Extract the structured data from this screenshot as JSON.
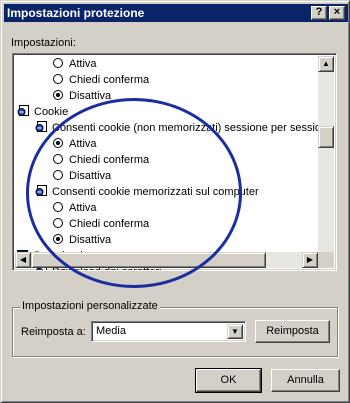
{
  "window": {
    "title": "Impostazioni protezione",
    "help_button": "?",
    "close_button": "×"
  },
  "settings": {
    "label": "Impostazioni:",
    "items": [
      {
        "kind": "radio",
        "label": "Attiva",
        "checked": false
      },
      {
        "kind": "radio",
        "label": "Chiedi conferma",
        "checked": false
      },
      {
        "kind": "radio",
        "label": "Disattiva",
        "checked": true
      },
      {
        "kind": "category",
        "label": "Cookie",
        "icon": "settings-page-icon"
      },
      {
        "kind": "subcategory",
        "label": "Consenti cookie (non memorizzati) sessione per sessione",
        "icon": "settings-page-icon"
      },
      {
        "kind": "radio",
        "label": "Attiva",
        "checked": true
      },
      {
        "kind": "radio",
        "label": "Chiedi conferma",
        "checked": false
      },
      {
        "kind": "radio",
        "label": "Disattiva",
        "checked": false
      },
      {
        "kind": "subcategory",
        "label": "Consenti cookie memorizzati sul computer",
        "icon": "settings-page-icon"
      },
      {
        "kind": "radio",
        "label": "Attiva",
        "checked": false
      },
      {
        "kind": "radio",
        "label": "Chiedi conferma",
        "checked": false
      },
      {
        "kind": "radio",
        "label": "Disattiva",
        "checked": true
      },
      {
        "kind": "category",
        "label": "Download",
        "icon": "download-icon"
      },
      {
        "kind": "subcategory",
        "label": "Download dei caratteri",
        "icon": "settings-page-icon"
      }
    ]
  },
  "custom": {
    "group_title": "Impostazioni personalizzate",
    "reset_label": "Reimposta a:",
    "reset_value": "Media",
    "reset_button": "Reimposta"
  },
  "footer": {
    "ok": "OK",
    "cancel": "Annulla"
  },
  "colors": {
    "titlebar": "#0a246a",
    "annotation_circle": "#1a2ea0"
  }
}
